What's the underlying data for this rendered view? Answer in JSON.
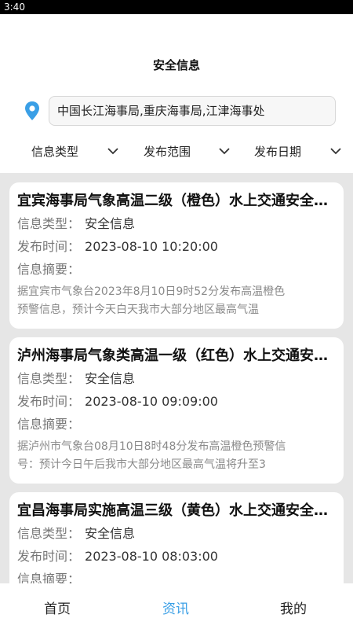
{
  "status_bar": {
    "time": "3:40"
  },
  "header": {
    "title": "安全信息"
  },
  "search": {
    "value": "中国长江海事局,重庆海事局,江津海事处",
    "icon": "location-pin-icon"
  },
  "filters": [
    {
      "label": "信息类型"
    },
    {
      "label": "发布范围"
    },
    {
      "label": "发布日期"
    }
  ],
  "cards": [
    {
      "title": "宜宾海事局气象高温二级（橙色）水上交通安全预警信息",
      "type_label": "信息类型：",
      "type_value": "安全信息",
      "time_label": "发布时间：",
      "time_value": "2023-08-10 10:20:00",
      "summary_label": "信息摘要：",
      "summary_line1": "据宜宾市气象台2023年8月10日9时52分发布高温橙色",
      "summary_line2": "预警信息，预计今天白天我市大部分地区最高气温"
    },
    {
      "title": "泸州海事局气象类高温一级（红色）水上交通安全预警信息",
      "type_label": "信息类型：",
      "type_value": "安全信息",
      "time_label": "发布时间：",
      "time_value": "2023-08-10 09:09:00",
      "summary_label": "信息摘要：",
      "summary_line1": "据泸州市气象台08月10日8时48分发布高温橙色预警信",
      "summary_line2": "号：预计今日午后我市大部分地区最高气温将升至3"
    },
    {
      "title": "宜昌海事局实施高温三级（黄色）水上交通安全预警信息",
      "type_label": "信息类型：",
      "type_value": "安全信息",
      "time_label": "发布时间：",
      "time_value": "2023-08-10 08:03:00",
      "summary_label": "信息摘要："
    }
  ],
  "bottom_nav": [
    {
      "label": "首页"
    },
    {
      "label": "资讯",
      "active": true
    },
    {
      "label": "我的"
    }
  ],
  "colors": {
    "accent": "#3a9fe6",
    "list_bg": "#e6e6e6"
  }
}
